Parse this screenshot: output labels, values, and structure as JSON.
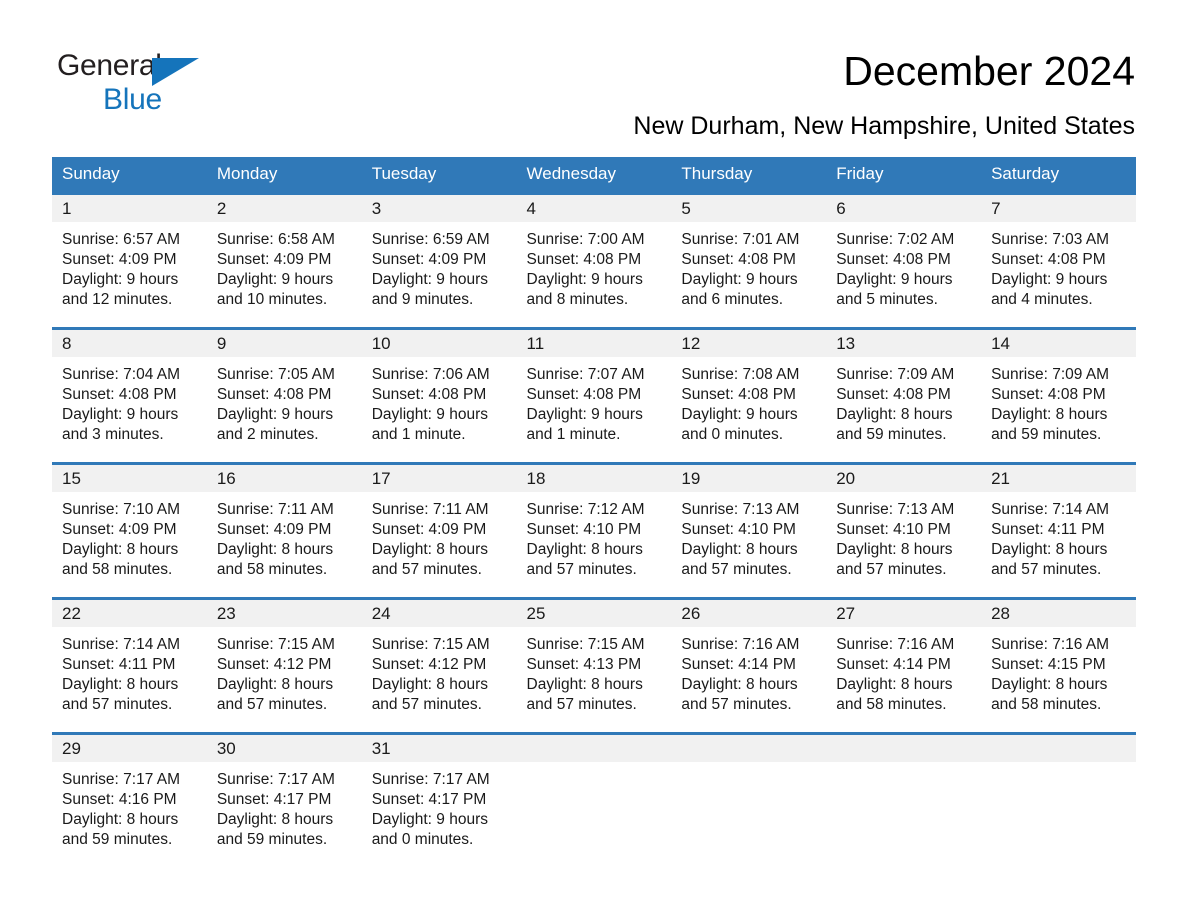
{
  "brand": {
    "line1": "General",
    "line2": "Blue",
    "triangle_icon": "brand-triangle-icon"
  },
  "header": {
    "month_title": "December 2024",
    "location": "New Durham, New Hampshire, United States"
  },
  "colors": {
    "header_blue": "#3079b8",
    "brand_blue": "#1574bb",
    "daynum_strip": "#f1f1f1",
    "text": "#1a1a1a"
  },
  "weekday_headers": [
    "Sunday",
    "Monday",
    "Tuesday",
    "Wednesday",
    "Thursday",
    "Friday",
    "Saturday"
  ],
  "weeks": [
    [
      {
        "day": "1",
        "sunrise": "Sunrise: 6:57 AM",
        "sunset": "Sunset: 4:09 PM",
        "daylight1": "Daylight: 9 hours",
        "daylight2": "and 12 minutes."
      },
      {
        "day": "2",
        "sunrise": "Sunrise: 6:58 AM",
        "sunset": "Sunset: 4:09 PM",
        "daylight1": "Daylight: 9 hours",
        "daylight2": "and 10 minutes."
      },
      {
        "day": "3",
        "sunrise": "Sunrise: 6:59 AM",
        "sunset": "Sunset: 4:09 PM",
        "daylight1": "Daylight: 9 hours",
        "daylight2": "and 9 minutes."
      },
      {
        "day": "4",
        "sunrise": "Sunrise: 7:00 AM",
        "sunset": "Sunset: 4:08 PM",
        "daylight1": "Daylight: 9 hours",
        "daylight2": "and 8 minutes."
      },
      {
        "day": "5",
        "sunrise": "Sunrise: 7:01 AM",
        "sunset": "Sunset: 4:08 PM",
        "daylight1": "Daylight: 9 hours",
        "daylight2": "and 6 minutes."
      },
      {
        "day": "6",
        "sunrise": "Sunrise: 7:02 AM",
        "sunset": "Sunset: 4:08 PM",
        "daylight1": "Daylight: 9 hours",
        "daylight2": "and 5 minutes."
      },
      {
        "day": "7",
        "sunrise": "Sunrise: 7:03 AM",
        "sunset": "Sunset: 4:08 PM",
        "daylight1": "Daylight: 9 hours",
        "daylight2": "and 4 minutes."
      }
    ],
    [
      {
        "day": "8",
        "sunrise": "Sunrise: 7:04 AM",
        "sunset": "Sunset: 4:08 PM",
        "daylight1": "Daylight: 9 hours",
        "daylight2": "and 3 minutes."
      },
      {
        "day": "9",
        "sunrise": "Sunrise: 7:05 AM",
        "sunset": "Sunset: 4:08 PM",
        "daylight1": "Daylight: 9 hours",
        "daylight2": "and 2 minutes."
      },
      {
        "day": "10",
        "sunrise": "Sunrise: 7:06 AM",
        "sunset": "Sunset: 4:08 PM",
        "daylight1": "Daylight: 9 hours",
        "daylight2": "and 1 minute."
      },
      {
        "day": "11",
        "sunrise": "Sunrise: 7:07 AM",
        "sunset": "Sunset: 4:08 PM",
        "daylight1": "Daylight: 9 hours",
        "daylight2": "and 1 minute."
      },
      {
        "day": "12",
        "sunrise": "Sunrise: 7:08 AM",
        "sunset": "Sunset: 4:08 PM",
        "daylight1": "Daylight: 9 hours",
        "daylight2": "and 0 minutes."
      },
      {
        "day": "13",
        "sunrise": "Sunrise: 7:09 AM",
        "sunset": "Sunset: 4:08 PM",
        "daylight1": "Daylight: 8 hours",
        "daylight2": "and 59 minutes."
      },
      {
        "day": "14",
        "sunrise": "Sunrise: 7:09 AM",
        "sunset": "Sunset: 4:08 PM",
        "daylight1": "Daylight: 8 hours",
        "daylight2": "and 59 minutes."
      }
    ],
    [
      {
        "day": "15",
        "sunrise": "Sunrise: 7:10 AM",
        "sunset": "Sunset: 4:09 PM",
        "daylight1": "Daylight: 8 hours",
        "daylight2": "and 58 minutes."
      },
      {
        "day": "16",
        "sunrise": "Sunrise: 7:11 AM",
        "sunset": "Sunset: 4:09 PM",
        "daylight1": "Daylight: 8 hours",
        "daylight2": "and 58 minutes."
      },
      {
        "day": "17",
        "sunrise": "Sunrise: 7:11 AM",
        "sunset": "Sunset: 4:09 PM",
        "daylight1": "Daylight: 8 hours",
        "daylight2": "and 57 minutes."
      },
      {
        "day": "18",
        "sunrise": "Sunrise: 7:12 AM",
        "sunset": "Sunset: 4:10 PM",
        "daylight1": "Daylight: 8 hours",
        "daylight2": "and 57 minutes."
      },
      {
        "day": "19",
        "sunrise": "Sunrise: 7:13 AM",
        "sunset": "Sunset: 4:10 PM",
        "daylight1": "Daylight: 8 hours",
        "daylight2": "and 57 minutes."
      },
      {
        "day": "20",
        "sunrise": "Sunrise: 7:13 AM",
        "sunset": "Sunset: 4:10 PM",
        "daylight1": "Daylight: 8 hours",
        "daylight2": "and 57 minutes."
      },
      {
        "day": "21",
        "sunrise": "Sunrise: 7:14 AM",
        "sunset": "Sunset: 4:11 PM",
        "daylight1": "Daylight: 8 hours",
        "daylight2": "and 57 minutes."
      }
    ],
    [
      {
        "day": "22",
        "sunrise": "Sunrise: 7:14 AM",
        "sunset": "Sunset: 4:11 PM",
        "daylight1": "Daylight: 8 hours",
        "daylight2": "and 57 minutes."
      },
      {
        "day": "23",
        "sunrise": "Sunrise: 7:15 AM",
        "sunset": "Sunset: 4:12 PM",
        "daylight1": "Daylight: 8 hours",
        "daylight2": "and 57 minutes."
      },
      {
        "day": "24",
        "sunrise": "Sunrise: 7:15 AM",
        "sunset": "Sunset: 4:12 PM",
        "daylight1": "Daylight: 8 hours",
        "daylight2": "and 57 minutes."
      },
      {
        "day": "25",
        "sunrise": "Sunrise: 7:15 AM",
        "sunset": "Sunset: 4:13 PM",
        "daylight1": "Daylight: 8 hours",
        "daylight2": "and 57 minutes."
      },
      {
        "day": "26",
        "sunrise": "Sunrise: 7:16 AM",
        "sunset": "Sunset: 4:14 PM",
        "daylight1": "Daylight: 8 hours",
        "daylight2": "and 57 minutes."
      },
      {
        "day": "27",
        "sunrise": "Sunrise: 7:16 AM",
        "sunset": "Sunset: 4:14 PM",
        "daylight1": "Daylight: 8 hours",
        "daylight2": "and 58 minutes."
      },
      {
        "day": "28",
        "sunrise": "Sunrise: 7:16 AM",
        "sunset": "Sunset: 4:15 PM",
        "daylight1": "Daylight: 8 hours",
        "daylight2": "and 58 minutes."
      }
    ],
    [
      {
        "day": "29",
        "sunrise": "Sunrise: 7:17 AM",
        "sunset": "Sunset: 4:16 PM",
        "daylight1": "Daylight: 8 hours",
        "daylight2": "and 59 minutes."
      },
      {
        "day": "30",
        "sunrise": "Sunrise: 7:17 AM",
        "sunset": "Sunset: 4:17 PM",
        "daylight1": "Daylight: 8 hours",
        "daylight2": "and 59 minutes."
      },
      {
        "day": "31",
        "sunrise": "Sunrise: 7:17 AM",
        "sunset": "Sunset: 4:17 PM",
        "daylight1": "Daylight: 9 hours",
        "daylight2": "and 0 minutes."
      },
      {
        "day": "",
        "sunrise": "",
        "sunset": "",
        "daylight1": "",
        "daylight2": ""
      },
      {
        "day": "",
        "sunrise": "",
        "sunset": "",
        "daylight1": "",
        "daylight2": ""
      },
      {
        "day": "",
        "sunrise": "",
        "sunset": "",
        "daylight1": "",
        "daylight2": ""
      },
      {
        "day": "",
        "sunrise": "",
        "sunset": "",
        "daylight1": "",
        "daylight2": ""
      }
    ]
  ]
}
